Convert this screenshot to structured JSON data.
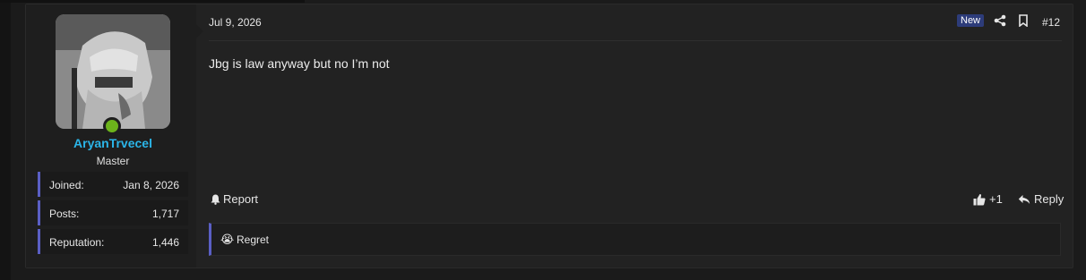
{
  "user": {
    "name": "AryanTrvecel",
    "title": "Master",
    "online": true,
    "stats": [
      {
        "label": "Joined:",
        "value": "Jan 8, 2026"
      },
      {
        "label": "Posts:",
        "value": "1,717"
      },
      {
        "label": "Reputation:",
        "value": "1,446"
      }
    ]
  },
  "post": {
    "date": "Jul 9, 2026",
    "new_badge": "New",
    "number": "#12",
    "message": "Jbg is law anyway but no I’m not"
  },
  "actions": {
    "report": "Report",
    "like_count": "+1",
    "reply": "Reply"
  },
  "reactions": {
    "emoji": "😭",
    "label": "Regret"
  },
  "icons": [
    "share-icon",
    "bookmark-icon",
    "bell-icon",
    "thumbs-up-icon",
    "reply-icon"
  ],
  "colors": {
    "username": "#2bb5e8",
    "online": "#6cb31b",
    "accent": "#5a5fc4",
    "badge": "#2d3c7a"
  }
}
